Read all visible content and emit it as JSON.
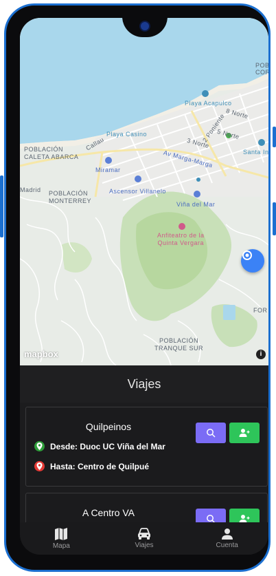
{
  "map": {
    "labels": {
      "poblacion_caleta_abarca": "POBLACIÓN\nCALETA ABARCA",
      "playa_acapulco": "Playa Acapulco",
      "playa_casino": "Playa Casino",
      "callau": "Callau",
      "ocho_norte": "8 Norte",
      "cinco_norte": "5 Norte",
      "tres_norte": "3 Norte",
      "dos_poniente": "2 Poniente",
      "av_marga_marga": "Av Marga-Marga",
      "miramar": "Miramar",
      "ascensor_villanelo": "Ascensor Villanelo",
      "vina_del_mar": "Viña del Mar",
      "madrid": "Madrid",
      "poblacion_monterrey": "POBLACIÓN\nMONTERREY",
      "anfiteatro": "Anfiteatro de la\nQuinta Vergara",
      "poblacion_tranque_sur": "POBLACIÓN\nTRANQUE SUR",
      "santa_ines": "Santa Inés",
      "for": "FOR",
      "pob": "POB\nCOR"
    },
    "attribution_logo": "mapbox",
    "attribution_info": "i"
  },
  "page_title": "Viajes",
  "trips": [
    {
      "name": "Quilpeinos",
      "from_label": "Desde: Duoc UC Viña del Mar",
      "to_label": "Hasta: Centro de Quilpué"
    },
    {
      "name": "A Centro VA"
    }
  ],
  "tabbar": {
    "items": [
      {
        "label": "Mapa",
        "icon": "map-icon"
      },
      {
        "label": "Viajes",
        "icon": "car-icon"
      },
      {
        "label": "Cuenta",
        "icon": "person-icon"
      }
    ]
  },
  "colors": {
    "frame": "#1b6fd0",
    "search_button": "#7b6cf5",
    "join_button": "#2ec55a",
    "locate_button": "#3b82f6",
    "pin_green": "#2e9e3a",
    "pin_red": "#e53935"
  }
}
